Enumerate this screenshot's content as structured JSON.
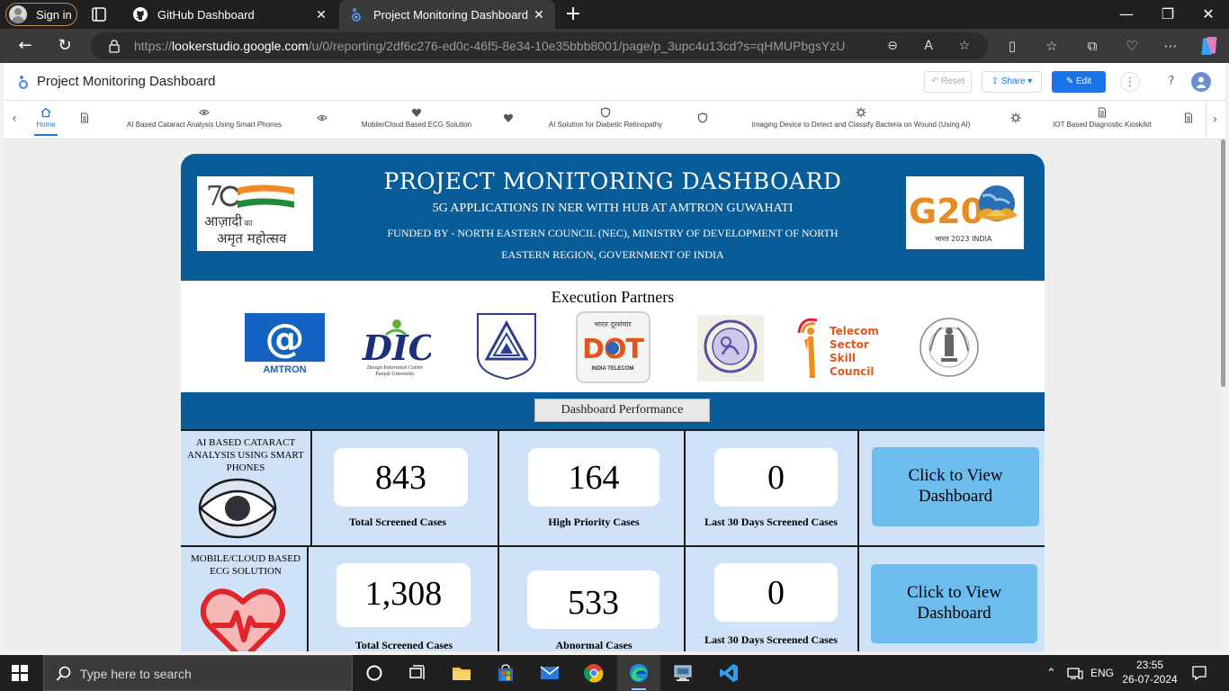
{
  "browser": {
    "signin_label": "Sign in",
    "tabs": [
      {
        "title": "GitHub Dashboard",
        "icon": "github-icon"
      },
      {
        "title": "Project Monitoring Dashboard",
        "icon": "looker-studio-icon"
      }
    ],
    "url_prefix": "https://",
    "url_host": "lookerstudio.google.com",
    "url_path": "/u/0/reporting/2df6c276-ed0c-46f5-8e34-10e35bbb8001/page/p_3upc4u13cd?s=qHMUPbgsYzU"
  },
  "looker": {
    "report_title": "Project Monitoring Dashboard",
    "reset_label": "Reset",
    "share_label": "Share",
    "edit_label": "Edit",
    "pages": [
      {
        "label": "Home",
        "icon": "home-icon",
        "active": true
      },
      {
        "label": "AI Based Cataract Analysis Using Smart Phones",
        "icon": "eye-icon"
      },
      {
        "label": "Mobile/Cloud Based ECG Solution",
        "icon": "heart-icon"
      },
      {
        "label": "AI Solution for Diabetic Retinopathy",
        "icon": "shield-icon"
      },
      {
        "label": "Imaging Device to Detect and Classify Bacteria on Wound (Using AI)",
        "icon": "gear-icon"
      },
      {
        "label": "IOT Based Diagnostic Kiosk/kit",
        "icon": "document-icon"
      }
    ]
  },
  "report": {
    "title": "PROJECT MONITORING DASHBOARD",
    "subtitle": "5G APPLICATIONS IN NER WITH HUB AT AMTRON GUWAHATI",
    "funded_by": "FUNDED BY - NORTH EASTERN COUNCIL (NEC), MINISTRY OF DEVELOPMENT  OF NORTH EASTERN REGION, GOVERNMENT OF INDIA",
    "left_logo": {
      "line1": "आज़ादी",
      "line1b": "का",
      "line2": "अमृत महोत्सव"
    },
    "right_logo": {
      "g20": "G20",
      "caption": "भारत 2023 INDIA"
    },
    "partners_title": "Execution Partners",
    "partners": {
      "amtron": "AMTRON",
      "dic_main": "DIC",
      "dic_sub1": "Design Innovation Centre",
      "dic_sub2": "Panjab University",
      "dot_top": "भारत दूरसंचार",
      "dot_main": "DOT",
      "dot_sub": "INDIA TELECOM",
      "tssc": [
        "Telecom",
        "Sector",
        "Skill",
        "Council"
      ]
    },
    "performance_label": "Dashboard Performance",
    "rows": [
      {
        "name": "AI BASED CATARACT ANALYSIS USING SMART PHONES",
        "icon": "eye-icon",
        "metrics": [
          {
            "value": "843",
            "label": "Total Screened Cases"
          },
          {
            "value": "164",
            "label": "High Priority Cases"
          },
          {
            "value": "0",
            "label": "Last 30 Days Screened Cases"
          }
        ],
        "button": "Click to View Dashboard"
      },
      {
        "name": "MOBILE/CLOUD BASED ECG SOLUTION",
        "icon": "heartbeat-icon",
        "metrics": [
          {
            "value": "1,308",
            "label": "Total Screened Cases"
          },
          {
            "value": "533",
            "label": "Abnormal Cases"
          },
          {
            "value": "0",
            "label": "Last 30 Days Screened  Cases"
          }
        ],
        "button": "Click to View Dashboard"
      }
    ]
  },
  "taskbar": {
    "search_placeholder": "Type here to search",
    "language": "ENG",
    "time": "23:55",
    "date": "26-07-2024"
  }
}
